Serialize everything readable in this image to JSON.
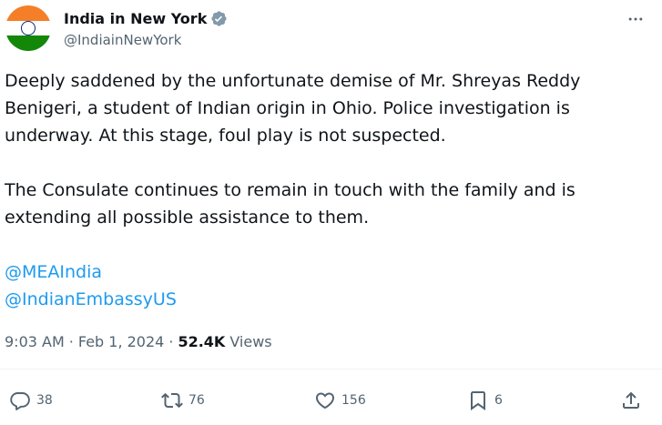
{
  "author": {
    "display_name": "India in New York",
    "handle": "@IndiainNewYork",
    "flag_colors": [
      "#f47f28",
      "#ffffff",
      "#138808"
    ],
    "verified_icon": "verified-badge-icon",
    "verified_color": "#829aab"
  },
  "tweet": {
    "paragraphs": [
      "Deeply saddened by the unfortunate demise of Mr. Shreyas Reddy Benigeri, a student of Indian origin in Ohio. Police investigation is underway. At this stage, foul play is not suspected.",
      "The Consulate continues to remain in touch with the family and is extending all possible assistance to them."
    ],
    "mentions": [
      "@MEAIndia",
      "@IndianEmbassyUS"
    ]
  },
  "meta": {
    "time": "9:03 AM",
    "separator": "·",
    "date": "Feb 1, 2024",
    "separator2": "·",
    "views_count": "52.4K",
    "views_label": "Views"
  },
  "actions": {
    "replies": "38",
    "reposts": "76",
    "likes": "156",
    "bookmarks": "6"
  },
  "colors": {
    "link": "#1d9bf0",
    "secondary_text": "#536471",
    "primary_text": "#0f1419"
  }
}
